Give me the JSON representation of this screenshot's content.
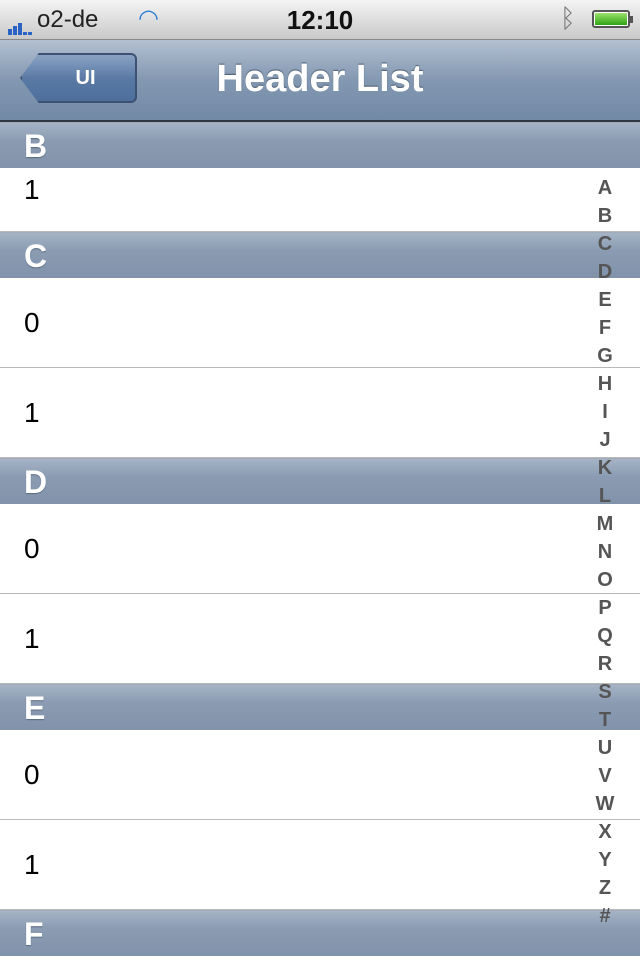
{
  "status": {
    "carrier": "o2-de",
    "time": "12:10"
  },
  "nav": {
    "back_label": "UI",
    "title": "Header List"
  },
  "sections": [
    {
      "title": "B",
      "rows": [
        "1"
      ]
    },
    {
      "title": "C",
      "rows": [
        "0",
        "1"
      ]
    },
    {
      "title": "D",
      "rows": [
        "0",
        "1"
      ]
    },
    {
      "title": "E",
      "rows": [
        "0",
        "1"
      ]
    },
    {
      "title": "F",
      "rows": []
    }
  ],
  "index": [
    "A",
    "B",
    "C",
    "D",
    "E",
    "F",
    "G",
    "H",
    "I",
    "J",
    "K",
    "L",
    "M",
    "N",
    "O",
    "P",
    "Q",
    "R",
    "S",
    "T",
    "U",
    "V",
    "W",
    "X",
    "Y",
    "Z",
    "#"
  ]
}
